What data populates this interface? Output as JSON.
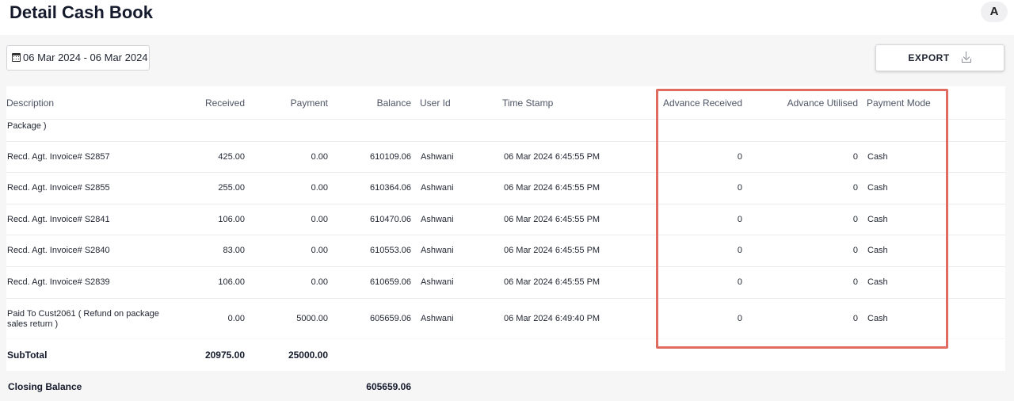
{
  "header": {
    "title": "Detail Cash Book",
    "avatar_initial": "A"
  },
  "filters": {
    "date_range": "06 Mar 2024 - 06 Mar 2024",
    "export_label": "EXPORT"
  },
  "table": {
    "columns": {
      "description": "Description",
      "received": "Received",
      "payment": "Payment",
      "balance": "Balance",
      "user_id": "User Id",
      "time_stamp": "Time Stamp",
      "advance_received": "Advance Received",
      "advance_utilised": "Advance Utilised",
      "payment_mode": "Payment Mode"
    },
    "partial_row_text": "Package )",
    "rows": [
      {
        "description": "Recd. Agt. Invoice# S2857",
        "received": "425.00",
        "payment": "0.00",
        "balance": "610109.06",
        "user_id": "Ashwani",
        "time_stamp": "06 Mar 2024 6:45:55 PM",
        "advance_received": "0",
        "advance_utilised": "0",
        "payment_mode": "Cash"
      },
      {
        "description": "Recd. Agt. Invoice# S2855",
        "received": "255.00",
        "payment": "0.00",
        "balance": "610364.06",
        "user_id": "Ashwani",
        "time_stamp": "06 Mar 2024 6:45:55 PM",
        "advance_received": "0",
        "advance_utilised": "0",
        "payment_mode": "Cash"
      },
      {
        "description": "Recd. Agt. Invoice# S2841",
        "received": "106.00",
        "payment": "0.00",
        "balance": "610470.06",
        "user_id": "Ashwani",
        "time_stamp": "06 Mar 2024 6:45:55 PM",
        "advance_received": "0",
        "advance_utilised": "0",
        "payment_mode": "Cash"
      },
      {
        "description": "Recd. Agt. Invoice# S2840",
        "received": "83.00",
        "payment": "0.00",
        "balance": "610553.06",
        "user_id": "Ashwani",
        "time_stamp": "06 Mar 2024 6:45:55 PM",
        "advance_received": "0",
        "advance_utilised": "0",
        "payment_mode": "Cash"
      },
      {
        "description": "Recd. Agt. Invoice# S2839",
        "received": "106.00",
        "payment": "0.00",
        "balance": "610659.06",
        "user_id": "Ashwani",
        "time_stamp": "06 Mar 2024 6:45:55 PM",
        "advance_received": "0",
        "advance_utilised": "0",
        "payment_mode": "Cash"
      },
      {
        "description_line1": "Paid To Cust2061 ( Refund on package",
        "description_line2": "sales return )",
        "received": "0.00",
        "payment": "5000.00",
        "balance": "605659.06",
        "user_id": "Ashwani",
        "time_stamp": "06 Mar 2024 6:49:40 PM",
        "advance_received": "0",
        "advance_utilised": "0",
        "payment_mode": "Cash"
      }
    ]
  },
  "subtotal": {
    "label": "SubTotal",
    "received": "20975.00",
    "payment": "25000.00"
  },
  "closing": {
    "label": "Closing Balance",
    "balance": "605659.06"
  },
  "colors": {
    "highlight": "#e06b61",
    "title": "#141a2c",
    "background": "#f6f6f6"
  },
  "icons": {
    "date": "calendar-icon",
    "export": "download-icon"
  }
}
